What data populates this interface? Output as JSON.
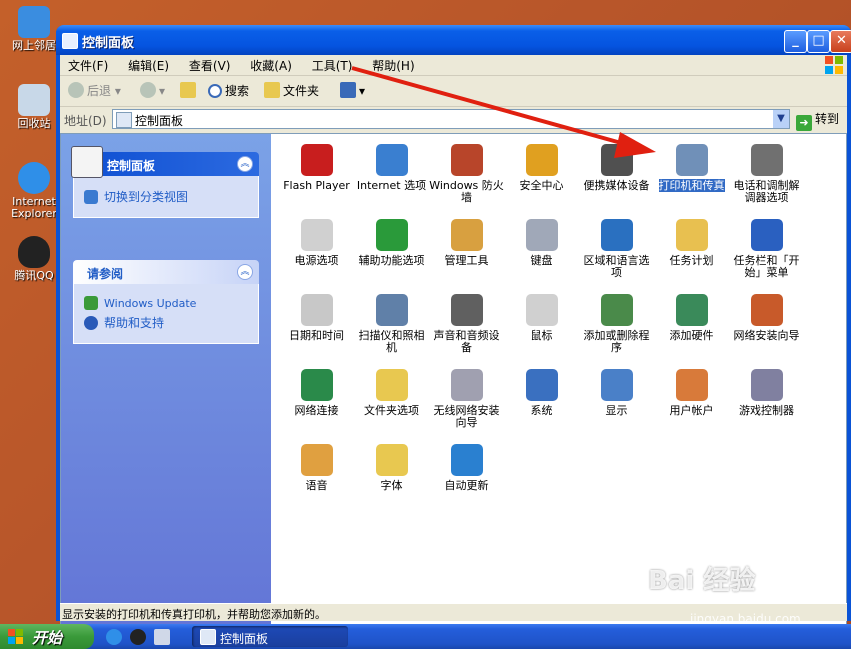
{
  "desktop": {
    "icons": [
      {
        "label": "网上邻居",
        "color": "#3a8de0"
      },
      {
        "label": "回收站",
        "color": "#c8d8e8"
      },
      {
        "label": "Internet Explorer",
        "color": "#2f8fe8"
      },
      {
        "label": "腾讯QQ",
        "color": "#222222"
      }
    ]
  },
  "window": {
    "title": "控制面板",
    "buttons": {
      "minimize": "_",
      "maximize": "□",
      "close": "✕"
    }
  },
  "menubar": [
    "文件(F)",
    "编辑(E)",
    "查看(V)",
    "收藏(A)",
    "工具(T)",
    "帮助(H)"
  ],
  "toolbar": {
    "back": "后退",
    "search": "搜索",
    "folders": "文件夹"
  },
  "address": {
    "label": "地址(D)",
    "value": "控制面板",
    "go": "转到"
  },
  "leftpane": {
    "panel1": {
      "title": "控制面板",
      "links": [
        "切换到分类视图"
      ]
    },
    "panel2": {
      "title": "请参阅",
      "links": [
        "Windows Update",
        "帮助和支持"
      ]
    }
  },
  "items": [
    {
      "label": "Flash Player",
      "icon": "flash-icon",
      "color": "#c81e1e"
    },
    {
      "label": "Internet 选项",
      "icon": "internet-options-icon",
      "color": "#3a7fd0"
    },
    {
      "label": "Windows 防火墙",
      "icon": "firewall-icon",
      "color": "#b8452a"
    },
    {
      "label": "安全中心",
      "icon": "shield-icon",
      "color": "#e0a020"
    },
    {
      "label": "便携媒体设备",
      "icon": "media-device-icon",
      "color": "#505050"
    },
    {
      "label": "打印机和传真",
      "icon": "printer-icon",
      "color": "#7090b8",
      "selected": true
    },
    {
      "label": "电话和调制解调器选项",
      "icon": "phone-icon",
      "color": "#707070"
    },
    {
      "label": "电源选项",
      "icon": "power-icon",
      "color": "#d0d0d0"
    },
    {
      "label": "辅助功能选项",
      "icon": "accessibility-icon",
      "color": "#2a9a3a"
    },
    {
      "label": "管理工具",
      "icon": "admin-tools-icon",
      "color": "#d8a040"
    },
    {
      "label": "键盘",
      "icon": "keyboard-icon",
      "color": "#a0a8b8"
    },
    {
      "label": "区域和语言选项",
      "icon": "globe-icon",
      "color": "#2a70c0"
    },
    {
      "label": "任务计划",
      "icon": "scheduled-tasks-icon",
      "color": "#e8c050"
    },
    {
      "label": "任务栏和「开始」菜单",
      "icon": "taskbar-icon",
      "color": "#2a60c0"
    },
    {
      "label": "日期和时间",
      "icon": "clock-icon",
      "color": "#c8c8c8"
    },
    {
      "label": "扫描仪和照相机",
      "icon": "scanner-icon",
      "color": "#6080a8"
    },
    {
      "label": "声音和音频设备",
      "icon": "speaker-icon",
      "color": "#606060"
    },
    {
      "label": "鼠标",
      "icon": "mouse-icon",
      "color": "#d0d0d0"
    },
    {
      "label": "添加或删除程序",
      "icon": "add-remove-icon",
      "color": "#4a8a4a"
    },
    {
      "label": "添加硬件",
      "icon": "hardware-icon",
      "color": "#3a8a5a"
    },
    {
      "label": "网络安装向导",
      "icon": "network-wizard-icon",
      "color": "#c85a2a"
    },
    {
      "label": "网络连接",
      "icon": "network-icon",
      "color": "#2a8a4a"
    },
    {
      "label": "文件夹选项",
      "icon": "folder-options-icon",
      "color": "#e8c850"
    },
    {
      "label": "无线网络安装向导",
      "icon": "wireless-icon",
      "color": "#a0a0b0"
    },
    {
      "label": "系统",
      "icon": "system-icon",
      "color": "#3a70c0"
    },
    {
      "label": "显示",
      "icon": "display-icon",
      "color": "#4a80c8"
    },
    {
      "label": "用户帐户",
      "icon": "user-accounts-icon",
      "color": "#d87a3a"
    },
    {
      "label": "游戏控制器",
      "icon": "game-controller-icon",
      "color": "#8080a0"
    },
    {
      "label": "语音",
      "icon": "speech-icon",
      "color": "#e0a040"
    },
    {
      "label": "字体",
      "icon": "fonts-icon",
      "color": "#e8c850"
    },
    {
      "label": "自动更新",
      "icon": "auto-update-icon",
      "color": "#2a80d0"
    }
  ],
  "statusbar": "显示安装的打印机和传真打印机，并帮助您添加新的。",
  "taskbar": {
    "start": "开始",
    "task": "控制面板"
  },
  "watermark": {
    "brand": "Bai 经验",
    "url": "jingyan.baidu.com"
  },
  "colors": {
    "selection": "#316ac5",
    "arrow": "#e02010"
  }
}
